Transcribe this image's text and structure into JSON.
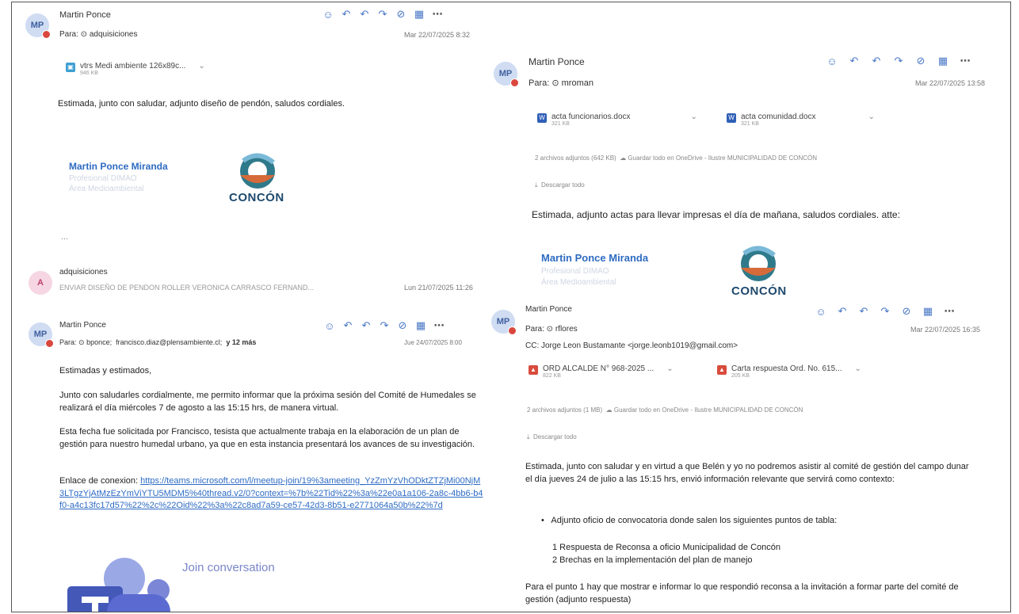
{
  "colors": {
    "accent": "#2e6bc2",
    "avatar_dot": "#d9473e"
  },
  "icons": [
    "smile-icon",
    "reply-icon",
    "reply-all-icon",
    "forward-icon",
    "shield-icon",
    "grid-icon",
    "more-icon"
  ],
  "msg1": {
    "avatar": "MP",
    "sender": "Martin Ponce",
    "to_label": "Para:",
    "to": "adquisiciones",
    "date": "Mar 22/07/2025 8:32",
    "attachment": {
      "name": "vtrs Medi ambiente 126x89c...",
      "size": "946 KB"
    },
    "body": "Estimada, junto con saludar, adjunto diseño de pendón, saludos cordiales.",
    "sig_name": "Martin Ponce Miranda",
    "sig_title": "Profesional DIMAO",
    "sig_area": "Área Medioambiental",
    "logo_text": "CONCÓN",
    "ellipsis": "..."
  },
  "msg2": {
    "avatar": "A",
    "sender": "adquisiciones",
    "preview": "ENVIAR DISEÑO DE PENDON ROLLER VERONICA CARRASCO FERNAND...",
    "date": "Lun 21/07/2025 11:26"
  },
  "msg3": {
    "avatar": "MP",
    "sender": "Martin Ponce",
    "to_label": "Para:",
    "to": "bponce;",
    "to_extra": "francisco.diaz@plensambiente.cl;",
    "more": "y 12 más",
    "date": "Jue 24/07/2025 8:00",
    "p1": "Estimadas y estimados,",
    "p2": "Junto con saludarles cordialmente, me permito informar que la próxima sesión del Comité de Humedales se realizará el día miércoles 7 de agosto a las 15:15 hrs, de manera virtual.",
    "p3": "Esta fecha fue solicitada por Francisco, tesista que actualmente trabaja en la elaboración de un plan de gestión para nuestro humedal urbano, ya que en esta instancia presentará los avances de su investigación.",
    "link_label": "Enlace de conexion:",
    "link": "https://teams.microsoft.com/l/meetup-join/19%3ameeting_YzZmYzVhODktZTZjMi00NjM3LTgzYjAtMzEzYmViYTU5MDM5%40thread.v2/0?context=%7b%22Tid%22%3a%22e0a1a106-2a8c-4bb6-b4f0-a4c13fc17d57%22%2c%22Oid%22%3a%22c8ad7a59-ce57-42d3-8b51-e2771064a50b%22%7d",
    "join": "Join conversation"
  },
  "msg4": {
    "avatar": "MP",
    "sender": "Martin Ponce",
    "to_label": "Para:",
    "to": "mroman",
    "date": "Mar 22/07/2025 13:58",
    "att1": {
      "name": "acta funcionarios.docx",
      "size": "321 KB"
    },
    "att2": {
      "name": "acta comunidad.docx",
      "size": "321 KB"
    },
    "summary": "2 archivos adjuntos (642 KB)",
    "save": "Guardar todo en OneDrive - Ilustre MUNICIPALIDAD DE CONCÓN",
    "download": "Descargar todo",
    "body": "Estimada, adjunto actas para llevar impresas el día de mañana, saludos cordiales. atte:",
    "sig_name": "Martin Ponce Miranda",
    "sig_title": "Profesional DIMAO",
    "sig_area": "Área Medioambiental",
    "logo_text": "CONCÓN"
  },
  "msg5": {
    "avatar": "MP",
    "sender": "Martin Ponce",
    "to_label": "Para:",
    "to": "rflores",
    "date": "Mar 22/07/2025 16:35",
    "cc": "CC: Jorge Leon Bustamante <jorge.leonb1019@gmail.com>",
    "att1": {
      "name": "ORD ALCALDE N° 968-2025 ...",
      "size": "822 KB"
    },
    "att2": {
      "name": "Carta respuesta Ord. No. 615...",
      "size": "205 KB"
    },
    "summary": "2 archivos adjuntos (1 MB)",
    "save": "Guardar todo en OneDrive - Ilustre MUNICIPALIDAD DE CONCÓN",
    "download": "Descargar todo",
    "p1": "Estimada, junto con saludar y en virtud a que Belén y yo no podremos asistir al comité de gestión del campo dunar el día jueves 24 de julio a las 15:15 hrs, envió información relevante que servirá como contexto:",
    "bullet": "Adjunto oficio de convocatoria donde salen los siguientes puntos de tabla:",
    "item1": "1 Respuesta de Reconsa a oficio Municipalidad de Concón",
    "item2": "2 Brechas en la implementación del plan de manejo",
    "p2": "Para el punto 1 hay que mostrar e informar lo que respondió reconsa a la invitación a formar parte del comité de gestión (adjunto respuesta)"
  }
}
